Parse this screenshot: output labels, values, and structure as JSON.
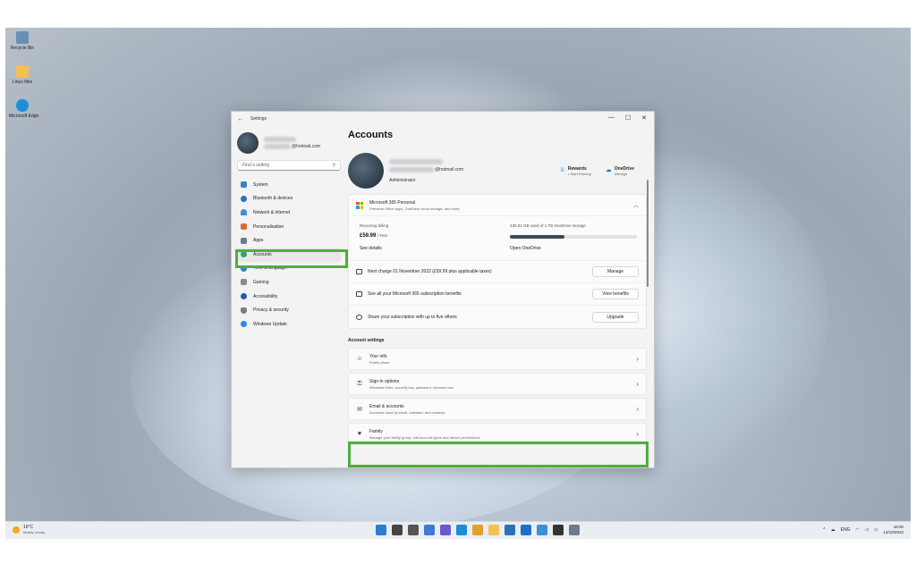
{
  "desktop": {
    "icons": [
      {
        "label": "Recycle Bin",
        "icon": "recycle-bin-icon",
        "color": "#6a8fb3"
      },
      {
        "label": "Linux files",
        "icon": "folder-icon",
        "color": "#f2c14e"
      },
      {
        "label": "Microsoft Edge",
        "icon": "edge-icon",
        "color": "#1a8fd6"
      }
    ]
  },
  "window": {
    "title": "Settings",
    "minimize": "—",
    "maximize": "☐",
    "close": "✕"
  },
  "sidebar": {
    "email_tail": "@hotmail.com",
    "search_placeholder": "Find a setting",
    "items": [
      {
        "label": "System",
        "color": "#3b82c4"
      },
      {
        "label": "Bluetooth & devices",
        "color": "#2d6fb6"
      },
      {
        "label": "Network & internet",
        "color": "#3d8fd8"
      },
      {
        "label": "Personalisation",
        "color": "#d36b3a"
      },
      {
        "label": "Apps",
        "color": "#6b7a8c"
      },
      {
        "label": "Accounts",
        "color": "#2fa36b"
      },
      {
        "label": "Time & language",
        "color": "#2c7fd0"
      },
      {
        "label": "Gaming",
        "color": "#8a8a8a"
      },
      {
        "label": "Accessibility",
        "color": "#1f5fa8"
      },
      {
        "label": "Privacy & security",
        "color": "#7a7f86"
      },
      {
        "label": "Windows Update",
        "color": "#2e86de"
      }
    ]
  },
  "content": {
    "page_title": "Accounts",
    "account": {
      "email_tail": "@hotmail.com",
      "role": "Administrator"
    },
    "quick": [
      {
        "title": "Rewards",
        "subtitle": "• Start Earning",
        "icon": "rewards-icon"
      },
      {
        "title": "OneDrive",
        "subtitle": "Manage",
        "icon": "cloud-icon"
      }
    ],
    "m365": {
      "title": "Microsoft 365 Personal",
      "subtitle": "Premium Office apps, OneDrive cloud storage, and more",
      "billing_label": "Recurring billing",
      "price": "£59.99",
      "period": " / Year",
      "see_details": "See details",
      "storage_text": "435.01 GB used of 1 TB OneDrive storage",
      "storage_used": 0.43,
      "open_onedrive": "Open OneDrive",
      "rows": [
        {
          "text": "Next charge 01 November 2022 (£59.99 plus applicable taxes)",
          "button": "Manage"
        },
        {
          "text": "See all your Microsoft 365 subscription benefits",
          "button": "View benefits"
        },
        {
          "text": "Share your subscription with up to five others",
          "button": "Upgrade"
        }
      ]
    },
    "account_settings_title": "Account settings",
    "settings": [
      {
        "title": "Your info",
        "subtitle": "Profile photo",
        "icon": "person-card-icon",
        "glyph": "☺"
      },
      {
        "title": "Sign-in options",
        "subtitle": "Windows Hello, security key, password, dynamic lock",
        "icon": "key-icon",
        "glyph": "⚿"
      },
      {
        "title": "Email & accounts",
        "subtitle": "Accounts used by email, calendar, and contacts",
        "icon": "mail-icon",
        "glyph": "✉"
      },
      {
        "title": "Family",
        "subtitle": "Manage your family group, edit account types and device permissions",
        "icon": "heart-icon",
        "glyph": "♥"
      }
    ]
  },
  "taskbar": {
    "weather_temp": "16°C",
    "weather_desc": "Mostly cloudy",
    "language": "ENG",
    "time": "16:00",
    "date": "13/10/2022",
    "icons": [
      {
        "name": "start-icon",
        "color": "#2a7fd4"
      },
      {
        "name": "search-icon",
        "color": "#444444"
      },
      {
        "name": "task-view-icon",
        "color": "#555555"
      },
      {
        "name": "widgets-icon",
        "color": "#3b7bd0"
      },
      {
        "name": "chat-icon",
        "color": "#6a5acd"
      },
      {
        "name": "edge-icon",
        "color": "#1a8fd6"
      },
      {
        "name": "chrome-icon",
        "color": "#e0a030"
      },
      {
        "name": "file-explorer-icon",
        "color": "#f2c14e"
      },
      {
        "name": "store-icon",
        "color": "#2d6fb6"
      },
      {
        "name": "mail-icon",
        "color": "#1f6fc5"
      },
      {
        "name": "photos-icon",
        "color": "#3b8fd8"
      },
      {
        "name": "terminal-icon",
        "color": "#333333"
      },
      {
        "name": "settings-icon",
        "color": "#6b7a8c"
      }
    ]
  }
}
